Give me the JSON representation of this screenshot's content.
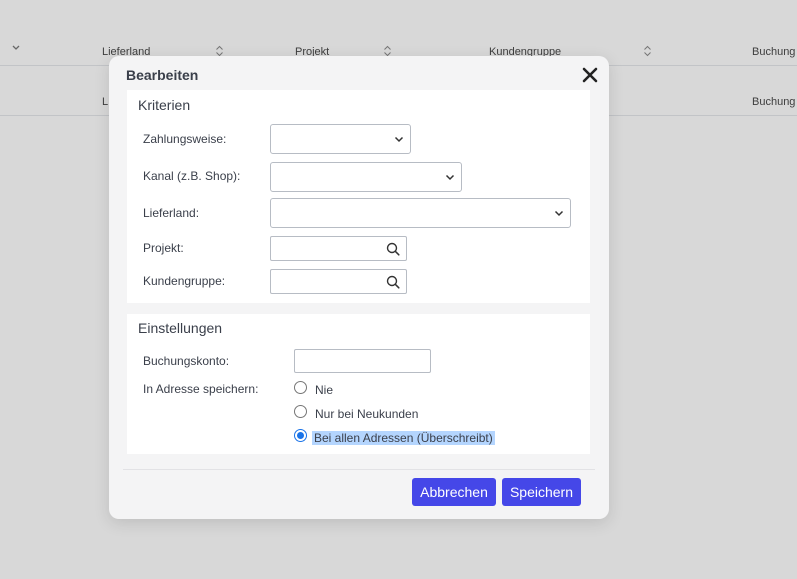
{
  "background_table": {
    "columns": [
      "Lieferland",
      "Projekt",
      "Kundengruppe",
      "Buchung"
    ],
    "row": {
      "first_cell": "L",
      "last_cell": "Buchung"
    }
  },
  "dialog": {
    "title": "Bearbeiten",
    "kriterien": {
      "title": "Kriterien",
      "zahlungsweise_label": "Zahlungsweise:",
      "zahlungsweise_value": "",
      "kanal_label": "Kanal (z.B. Shop):",
      "kanal_value": "",
      "lieferland_label": "Lieferland:",
      "lieferland_value": "",
      "projekt_label": "Projekt:",
      "projekt_value": "",
      "kundengruppe_label": "Kundengruppe:",
      "kundengruppe_value": ""
    },
    "einstellungen": {
      "title": "Einstellungen",
      "buchungskonto_label": "Buchungskonto:",
      "buchungskonto_value": "",
      "adresse_label": "In Adresse speichern:",
      "options": [
        "Nie",
        "Nur bei Neukunden",
        "Bei allen Adressen (Überschreibt)"
      ],
      "selected_index": 2
    },
    "buttons": {
      "cancel": "Abbrechen",
      "save": "Speichern"
    }
  },
  "colors": {
    "button": "#4547e8",
    "radio_selected": "#1a73e8",
    "selection_highlight": "#b4d5fe"
  }
}
